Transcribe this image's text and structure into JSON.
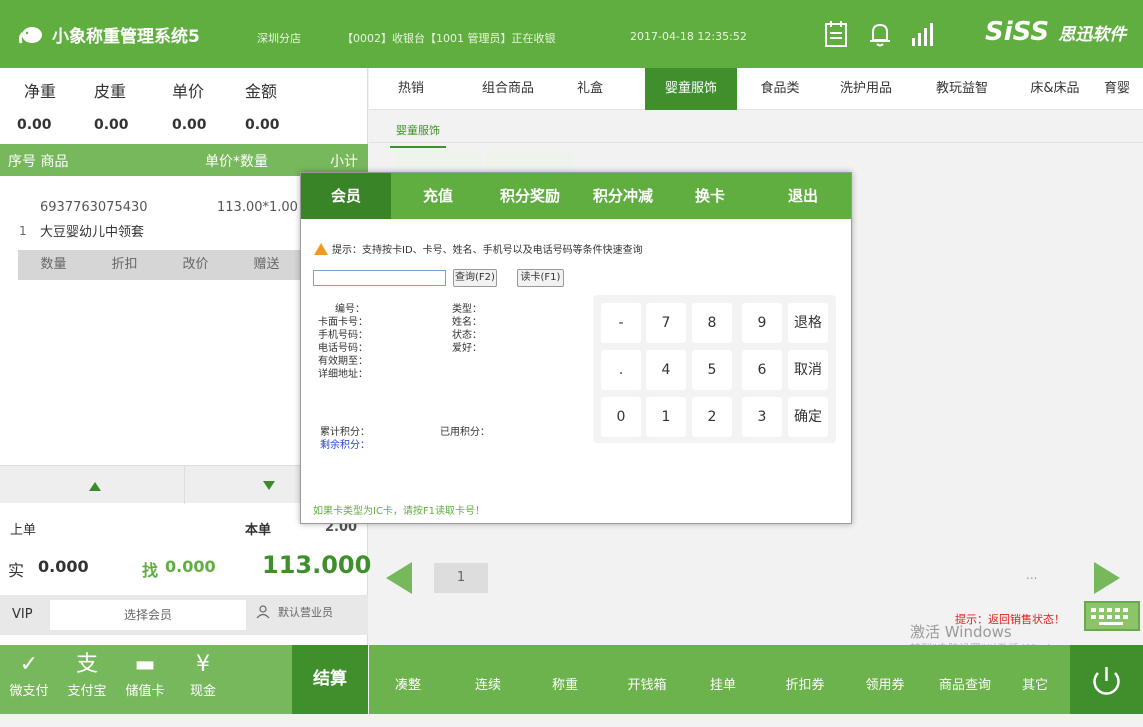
{
  "topbar": {
    "app_title": "小象称重管理系统5",
    "store": "深圳分店",
    "cashier_status": "【0002】收银台【1001 管理员】正在收银",
    "datetime": "2017-04-18 12:35:52",
    "brand": "SiSS",
    "brand_suffix": "思迅软件",
    "icons": [
      "notepad-icon",
      "bell-icon",
      "signal-icon"
    ]
  },
  "weigh": {
    "headers": [
      "净重",
      "皮重",
      "单价",
      "金额"
    ],
    "values": [
      "0.00",
      "0.00",
      "0.00",
      "0.00"
    ]
  },
  "list": {
    "header": {
      "no_item": "序号  商品",
      "price_qty": "单价*数量",
      "subtotal": "小计"
    },
    "items": [
      {
        "no": "1",
        "code": "6937763075430",
        "name": "大豆婴幼儿中领套",
        "price_qty": "113.00*1.00"
      }
    ],
    "actions": [
      "数量",
      "折扣",
      "改价",
      "赠送"
    ]
  },
  "summary": {
    "prev_label": "上单",
    "this_label": "本单",
    "this_partial": "2.00",
    "paid_label": "实",
    "paid_value": "0.000",
    "change_label": "找",
    "change_value": "0.000",
    "total": "113.000"
  },
  "vip": {
    "label": "VIP",
    "select_member": "选择会员",
    "default_staff": "默认营业员"
  },
  "payments": [
    {
      "label": "微支付",
      "icon": "chat-bubble-icon"
    },
    {
      "label": "支付宝",
      "icon": "alipay-icon"
    },
    {
      "label": "储值卡",
      "icon": "card-icon"
    },
    {
      "label": "现金",
      "icon": "cash-icon"
    }
  ],
  "settle_label": "结算",
  "categories": [
    "热销",
    "组合商品",
    "礼盒",
    "婴童服饰",
    "食品类",
    "洗护用品",
    "教玩益智",
    "床&床品",
    "育婴"
  ],
  "active_category": "婴童服饰",
  "subcategory": "婴童服饰",
  "page": "1",
  "ellipsis": "...",
  "bottom_actions": [
    "凑整",
    "连续",
    "称重",
    "开钱箱",
    "挂单",
    "折扣券",
    "领用券",
    "商品查询",
    "其它"
  ],
  "hint": "提示：返回销售状态！",
  "watermark": {
    "line1": "激活 Windows",
    "line2": "转到\"电脑设置\"以激活 Windows。"
  },
  "modal": {
    "tabs": [
      "会员",
      "充值",
      "积分奖励",
      "积分冲减",
      "换卡",
      "退出"
    ],
    "active_tab": "会员",
    "tip": "提示：支持按卡ID、卡号、姓名、手机号以及电话号码等条件快速查询",
    "input_value": "",
    "query_button": "查询(F2)",
    "read_card_button": "读卡(F1)",
    "fields_left": [
      "编号：",
      "卡面卡号：",
      "手机号码：",
      "电话号码：",
      "有效期至：",
      "详细地址："
    ],
    "fields_right": [
      "类型：",
      "姓名：",
      "状态：",
      "爱好："
    ],
    "points_total": "累计积分：",
    "points_used": "已用积分：",
    "points_left": "剩余积分：",
    "keypad": [
      [
        "-",
        "7",
        "8",
        "9",
        "退格"
      ],
      [
        ".",
        "4",
        "5",
        "6",
        "取消"
      ],
      [
        "0",
        "1",
        "2",
        "3",
        "确定"
      ]
    ],
    "footer": "如果卡类型为IC卡，请按F1读取卡号！"
  },
  "colors": {
    "primary_green": "#5fae3f",
    "dark_green": "#3f8f2c",
    "light_green": "#78b85c",
    "hint_red": "#e02020"
  }
}
